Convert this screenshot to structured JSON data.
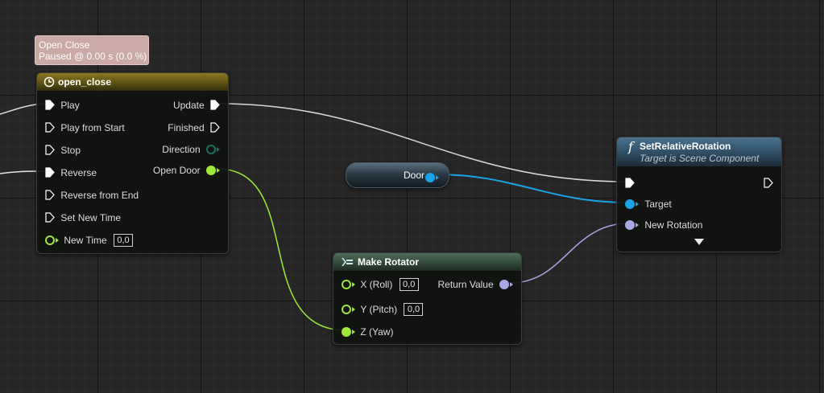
{
  "comment": {
    "line1": "Open Close",
    "line2": "Paused @ 0.00 s (0.0 %)"
  },
  "timeline_node": {
    "title": "open_close",
    "inputs": [
      {
        "label": "Play",
        "type": "exec",
        "connected": true
      },
      {
        "label": "Play from Start",
        "type": "exec",
        "connected": false
      },
      {
        "label": "Stop",
        "type": "exec",
        "connected": false
      },
      {
        "label": "Reverse",
        "type": "exec",
        "connected": true
      },
      {
        "label": "Reverse from End",
        "type": "exec",
        "connected": false
      },
      {
        "label": "Set New Time",
        "type": "exec",
        "connected": false
      },
      {
        "label": "New Time",
        "type": "float",
        "value": "0,0"
      }
    ],
    "outputs": [
      {
        "label": "Update",
        "type": "exec",
        "connected": true
      },
      {
        "label": "Finished",
        "type": "exec",
        "connected": false
      },
      {
        "label": "Direction",
        "type": "enum",
        "connected": false
      },
      {
        "label": "Open Door",
        "type": "float",
        "connected": true
      }
    ]
  },
  "door_variable": {
    "label": "Door"
  },
  "set_rotation_node": {
    "title": "SetRelativeRotation",
    "subtitle": "Target is Scene Component",
    "icon": "f",
    "inputs": [
      {
        "label": "Target"
      },
      {
        "label": "New Rotation"
      }
    ]
  },
  "make_rotator_node": {
    "title": "Make Rotator",
    "inputs": [
      {
        "label": "X (Roll)",
        "value": "0,0"
      },
      {
        "label": "Y (Pitch)",
        "value": "0,0"
      },
      {
        "label": "Z (Yaw)"
      }
    ],
    "output": {
      "label": "Return Value"
    }
  },
  "colors": {
    "exec": "#ffffff",
    "float": "#9ee83a",
    "enum": "#1e6e5e",
    "object": "#1aa3e6",
    "struct": "#a8a8e8",
    "timeline_header": "#8c7722",
    "function_header": "#4a7390",
    "comment_bg": "#caa9a6"
  }
}
